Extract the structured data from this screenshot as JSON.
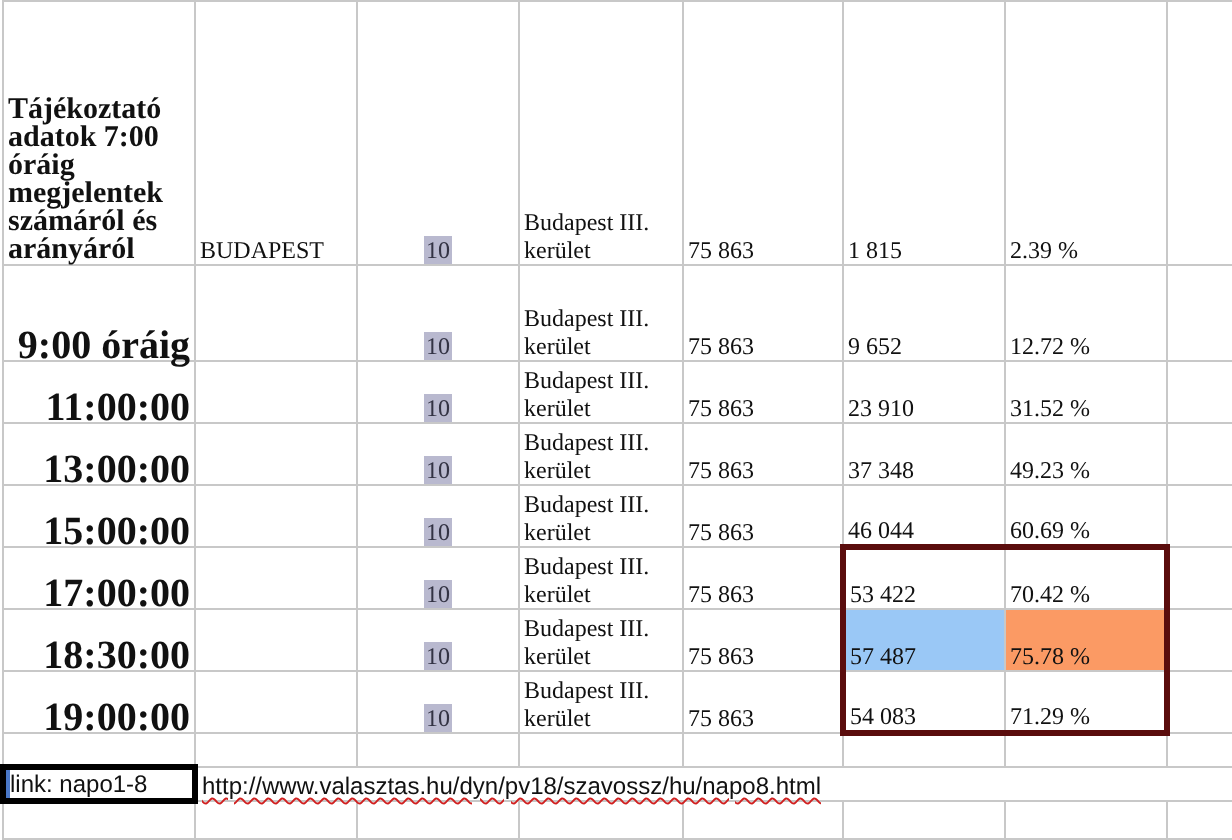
{
  "rows": [
    {
      "kind": "header",
      "label": "Tájékoztató adatok 7:00 óráig megjelentek számáról és arányáról",
      "region": "BUDAPEST",
      "code": "10",
      "district": "Budapest III. kerület",
      "voters": "75 863",
      "count": "1 815",
      "percent": "2.39 %",
      "outlined": false
    },
    {
      "kind": "tall",
      "label": "9:00 óráig",
      "code": "10",
      "district": "Budapest III. kerület",
      "voters": "75 863",
      "count": "9 652",
      "percent": "12.72 %",
      "outlined": false
    },
    {
      "kind": "normal",
      "label": "11:00:00",
      "code": "10",
      "district": "Budapest III. kerület",
      "voters": "75 863",
      "count": "23 910",
      "percent": "31.52 %",
      "outlined": false
    },
    {
      "kind": "normal",
      "label": "13:00:00",
      "code": "10",
      "district": "Budapest III. kerület",
      "voters": "75 863",
      "count": "37 348",
      "percent": "49.23 %",
      "outlined": false
    },
    {
      "kind": "normal",
      "label": "15:00:00",
      "code": "10",
      "district": "Budapest III. kerület",
      "voters": "75 863",
      "count": "46 044",
      "percent": "60.69 %",
      "outlined": false
    },
    {
      "kind": "normal",
      "label": "17:00:00",
      "code": "10",
      "district": "Budapest III. kerület",
      "voters": "75 863",
      "count": "53 422",
      "percent": "70.42 %",
      "outlined": true
    },
    {
      "kind": "normal",
      "label": "18:30:00",
      "code": "10",
      "district": "Budapest III. kerület",
      "voters": "75 863",
      "count": {
        "text": "57 487",
        "color": "#9ac8f6"
      },
      "percent": {
        "text": "75.78 %",
        "color": "#fb9a64"
      },
      "outlined": true
    },
    {
      "kind": "normal",
      "label": "19:00:00",
      "code": "10",
      "district": "Budapest III. kerület",
      "voters": "75 863",
      "count": "54 083",
      "percent": "71.29 %",
      "outlined": true
    }
  ],
  "footer": {
    "link_cell": {
      "text": "link: napo1-8",
      "selected": true
    },
    "url": "http://www.valasztas.hu/dyn/pv18/szavossz/hu/napo8.html"
  }
}
